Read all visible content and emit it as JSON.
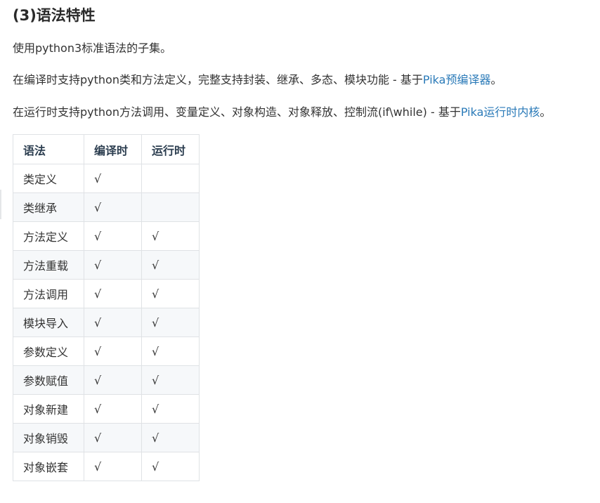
{
  "section": {
    "title": "(3)语法特性"
  },
  "paragraphs": {
    "p1": {
      "text": "使用python3标准语法的子集。"
    },
    "p2": {
      "before": "在编译时支持python类和方法定义，完整支持封装、继承、多态、模块功能 - 基于",
      "link": "Pika预编译器",
      "after": "。"
    },
    "p3": {
      "before": "在运行时支持python方法调用、变量定义、对象构造、对象释放、控制流(if\\while) - 基于",
      "link": "Pika运行时内核",
      "after": "。"
    }
  },
  "table": {
    "headers": [
      "语法",
      "编译时",
      "运行时"
    ],
    "rows": [
      [
        "类定义",
        "√",
        ""
      ],
      [
        "类继承",
        "√",
        ""
      ],
      [
        "方法定义",
        "√",
        "√"
      ],
      [
        "方法重载",
        "√",
        "√"
      ],
      [
        "方法调用",
        "√",
        "√"
      ],
      [
        "模块导入",
        "√",
        "√"
      ],
      [
        "参数定义",
        "√",
        "√"
      ],
      [
        "参数赋值",
        "√",
        "√"
      ],
      [
        "对象新建",
        "√",
        "√"
      ],
      [
        "对象销毁",
        "√",
        "√"
      ],
      [
        "对象嵌套",
        "√",
        "√"
      ]
    ]
  },
  "colors": {
    "link": "#2a7ab8",
    "text": "#333333",
    "table_border": "#dfe2e5",
    "stripe": "#f6f8fa"
  }
}
